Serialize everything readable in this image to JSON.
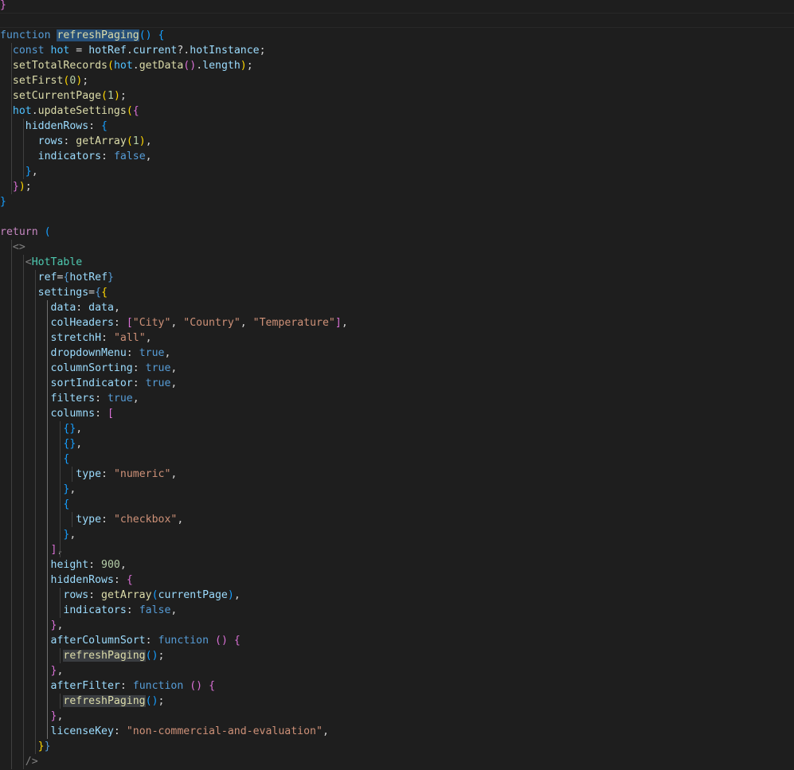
{
  "editor": {
    "background": "#1e1e1e",
    "lines": [
      [
        {
          "t": "}",
          "c": "b2"
        }
      ],
      [],
      [
        {
          "t": "function",
          "c": "kw"
        },
        {
          "t": " ",
          "c": "p"
        },
        {
          "t": "refreshPaging",
          "c": "fn hl"
        },
        {
          "t": "()",
          "c": "b3"
        },
        {
          "t": " ",
          "c": "p"
        },
        {
          "t": "{",
          "c": "b3"
        }
      ],
      [
        {
          "t": "  const",
          "c": "kw"
        },
        {
          "t": " ",
          "c": "p"
        },
        {
          "t": "hot",
          "c": "cst"
        },
        {
          "t": " = ",
          "c": "p"
        },
        {
          "t": "hotRef",
          "c": "var"
        },
        {
          "t": ".",
          "c": "p"
        },
        {
          "t": "current",
          "c": "var"
        },
        {
          "t": "?.",
          "c": "p"
        },
        {
          "t": "hotInstance",
          "c": "var"
        },
        {
          "t": ";",
          "c": "p"
        }
      ],
      [
        {
          "t": "  setTotalRecords",
          "c": "fn"
        },
        {
          "t": "(",
          "c": "b1"
        },
        {
          "t": "hot",
          "c": "cst"
        },
        {
          "t": ".",
          "c": "p"
        },
        {
          "t": "getData",
          "c": "fn"
        },
        {
          "t": "()",
          "c": "b2"
        },
        {
          "t": ".",
          "c": "p"
        },
        {
          "t": "length",
          "c": "var"
        },
        {
          "t": ")",
          "c": "b1"
        },
        {
          "t": ";",
          "c": "p"
        }
      ],
      [
        {
          "t": "  setFirst",
          "c": "fn"
        },
        {
          "t": "(",
          "c": "b1"
        },
        {
          "t": "0",
          "c": "num"
        },
        {
          "t": ")",
          "c": "b1"
        },
        {
          "t": ";",
          "c": "p"
        }
      ],
      [
        {
          "t": "  setCurrentPage",
          "c": "fn"
        },
        {
          "t": "(",
          "c": "b1"
        },
        {
          "t": "1",
          "c": "num"
        },
        {
          "t": ")",
          "c": "b1"
        },
        {
          "t": ";",
          "c": "p"
        }
      ],
      [
        {
          "t": "  hot",
          "c": "cst"
        },
        {
          "t": ".",
          "c": "p"
        },
        {
          "t": "updateSettings",
          "c": "fn"
        },
        {
          "t": "(",
          "c": "b1"
        },
        {
          "t": "{",
          "c": "b2"
        }
      ],
      [
        {
          "t": "    hiddenRows",
          "c": "var"
        },
        {
          "t": ": ",
          "c": "p"
        },
        {
          "t": "{",
          "c": "b3"
        }
      ],
      [
        {
          "t": "      rows",
          "c": "var"
        },
        {
          "t": ": ",
          "c": "p"
        },
        {
          "t": "getArray",
          "c": "fn"
        },
        {
          "t": "(",
          "c": "b1"
        },
        {
          "t": "1",
          "c": "num"
        },
        {
          "t": ")",
          "c": "b1"
        },
        {
          "t": ",",
          "c": "p"
        }
      ],
      [
        {
          "t": "      indicators",
          "c": "var"
        },
        {
          "t": ": ",
          "c": "p"
        },
        {
          "t": "false",
          "c": "kw"
        },
        {
          "t": ",",
          "c": "p"
        }
      ],
      [
        {
          "t": "    ",
          "c": "p"
        },
        {
          "t": "}",
          "c": "b3"
        },
        {
          "t": ",",
          "c": "p"
        }
      ],
      [
        {
          "t": "  ",
          "c": "p"
        },
        {
          "t": "}",
          "c": "b2"
        },
        {
          "t": ")",
          "c": "b1"
        },
        {
          "t": ";",
          "c": "p"
        }
      ],
      [
        {
          "t": "}",
          "c": "b3"
        }
      ],
      [],
      [
        {
          "t": "return",
          "c": "ctl"
        },
        {
          "t": " ",
          "c": "p"
        },
        {
          "t": "(",
          "c": "b3"
        }
      ],
      [
        {
          "t": "  <>",
          "c": "tagp"
        }
      ],
      [
        {
          "t": "    <",
          "c": "tagp"
        },
        {
          "t": "HotTable",
          "c": "tag"
        }
      ],
      [
        {
          "t": "      ref",
          "c": "var"
        },
        {
          "t": "=",
          "c": "p"
        },
        {
          "t": "{",
          "c": "kw"
        },
        {
          "t": "hotRef",
          "c": "var"
        },
        {
          "t": "}",
          "c": "kw"
        }
      ],
      [
        {
          "t": "      settings",
          "c": "var"
        },
        {
          "t": "=",
          "c": "p"
        },
        {
          "t": "{",
          "c": "kw"
        },
        {
          "t": "{",
          "c": "b1"
        }
      ],
      [
        {
          "t": "        data",
          "c": "var"
        },
        {
          "t": ": ",
          "c": "p"
        },
        {
          "t": "data",
          "c": "var"
        },
        {
          "t": ",",
          "c": "p"
        }
      ],
      [
        {
          "t": "        colHeaders",
          "c": "var"
        },
        {
          "t": ": ",
          "c": "p"
        },
        {
          "t": "[",
          "c": "b2"
        },
        {
          "t": "\"City\"",
          "c": "str"
        },
        {
          "t": ", ",
          "c": "p"
        },
        {
          "t": "\"Country\"",
          "c": "str"
        },
        {
          "t": ", ",
          "c": "p"
        },
        {
          "t": "\"Temperature\"",
          "c": "str"
        },
        {
          "t": "]",
          "c": "b2"
        },
        {
          "t": ",",
          "c": "p"
        }
      ],
      [
        {
          "t": "        stretchH",
          "c": "var"
        },
        {
          "t": ": ",
          "c": "p"
        },
        {
          "t": "\"all\"",
          "c": "str"
        },
        {
          "t": ",",
          "c": "p"
        }
      ],
      [
        {
          "t": "        dropdownMenu",
          "c": "var"
        },
        {
          "t": ": ",
          "c": "p"
        },
        {
          "t": "true",
          "c": "kw"
        },
        {
          "t": ",",
          "c": "p"
        }
      ],
      [
        {
          "t": "        columnSorting",
          "c": "var"
        },
        {
          "t": ": ",
          "c": "p"
        },
        {
          "t": "true",
          "c": "kw"
        },
        {
          "t": ",",
          "c": "p"
        }
      ],
      [
        {
          "t": "        sortIndicator",
          "c": "var"
        },
        {
          "t": ": ",
          "c": "p"
        },
        {
          "t": "true",
          "c": "kw"
        },
        {
          "t": ",",
          "c": "p"
        }
      ],
      [
        {
          "t": "        filters",
          "c": "var"
        },
        {
          "t": ": ",
          "c": "p"
        },
        {
          "t": "true",
          "c": "kw"
        },
        {
          "t": ",",
          "c": "p"
        }
      ],
      [
        {
          "t": "        columns",
          "c": "var"
        },
        {
          "t": ": ",
          "c": "p"
        },
        {
          "t": "[",
          "c": "b2"
        }
      ],
      [
        {
          "t": "          ",
          "c": "p"
        },
        {
          "t": "{}",
          "c": "b3"
        },
        {
          "t": ",",
          "c": "p"
        }
      ],
      [
        {
          "t": "          ",
          "c": "p"
        },
        {
          "t": "{}",
          "c": "b3"
        },
        {
          "t": ",",
          "c": "p"
        }
      ],
      [
        {
          "t": "          ",
          "c": "p"
        },
        {
          "t": "{",
          "c": "b3"
        }
      ],
      [
        {
          "t": "            type",
          "c": "var"
        },
        {
          "t": ": ",
          "c": "p"
        },
        {
          "t": "\"numeric\"",
          "c": "str"
        },
        {
          "t": ",",
          "c": "p"
        }
      ],
      [
        {
          "t": "          ",
          "c": "p"
        },
        {
          "t": "}",
          "c": "b3"
        },
        {
          "t": ",",
          "c": "p"
        }
      ],
      [
        {
          "t": "          ",
          "c": "p"
        },
        {
          "t": "{",
          "c": "b3"
        }
      ],
      [
        {
          "t": "            type",
          "c": "var"
        },
        {
          "t": ": ",
          "c": "p"
        },
        {
          "t": "\"checkbox\"",
          "c": "str"
        },
        {
          "t": ",",
          "c": "p"
        }
      ],
      [
        {
          "t": "          ",
          "c": "p"
        },
        {
          "t": "}",
          "c": "b3"
        },
        {
          "t": ",",
          "c": "p"
        }
      ],
      [
        {
          "t": "        ",
          "c": "p"
        },
        {
          "t": "]",
          "c": "b2"
        },
        {
          "t": ",",
          "c": "p"
        }
      ],
      [
        {
          "t": "        height",
          "c": "var"
        },
        {
          "t": ": ",
          "c": "p"
        },
        {
          "t": "900",
          "c": "num"
        },
        {
          "t": ",",
          "c": "p"
        }
      ],
      [
        {
          "t": "        hiddenRows",
          "c": "var"
        },
        {
          "t": ": ",
          "c": "p"
        },
        {
          "t": "{",
          "c": "b2"
        }
      ],
      [
        {
          "t": "          rows",
          "c": "var"
        },
        {
          "t": ": ",
          "c": "p"
        },
        {
          "t": "getArray",
          "c": "fn"
        },
        {
          "t": "(",
          "c": "b3"
        },
        {
          "t": "currentPage",
          "c": "var"
        },
        {
          "t": ")",
          "c": "b3"
        },
        {
          "t": ",",
          "c": "p"
        }
      ],
      [
        {
          "t": "          indicators",
          "c": "var"
        },
        {
          "t": ": ",
          "c": "p"
        },
        {
          "t": "false",
          "c": "kw"
        },
        {
          "t": ",",
          "c": "p"
        }
      ],
      [
        {
          "t": "        ",
          "c": "p"
        },
        {
          "t": "}",
          "c": "b2"
        },
        {
          "t": ",",
          "c": "p"
        }
      ],
      [
        {
          "t": "        afterColumnSort",
          "c": "var"
        },
        {
          "t": ": ",
          "c": "p"
        },
        {
          "t": "function",
          "c": "kw"
        },
        {
          "t": " ",
          "c": "p"
        },
        {
          "t": "()",
          "c": "b2"
        },
        {
          "t": " ",
          "c": "p"
        },
        {
          "t": "{",
          "c": "b2"
        }
      ],
      [
        {
          "t": "          ",
          "c": "p"
        },
        {
          "t": "refreshPaging",
          "c": "fn hl2"
        },
        {
          "t": "()",
          "c": "b3"
        },
        {
          "t": ";",
          "c": "p"
        }
      ],
      [
        {
          "t": "        ",
          "c": "p"
        },
        {
          "t": "}",
          "c": "b2"
        },
        {
          "t": ",",
          "c": "p"
        }
      ],
      [
        {
          "t": "        afterFilter",
          "c": "var"
        },
        {
          "t": ": ",
          "c": "p"
        },
        {
          "t": "function",
          "c": "kw"
        },
        {
          "t": " ",
          "c": "p"
        },
        {
          "t": "()",
          "c": "b2"
        },
        {
          "t": " ",
          "c": "p"
        },
        {
          "t": "{",
          "c": "b2"
        }
      ],
      [
        {
          "t": "          ",
          "c": "p"
        },
        {
          "t": "refreshPaging",
          "c": "fn hl2"
        },
        {
          "t": "()",
          "c": "b3"
        },
        {
          "t": ";",
          "c": "p"
        }
      ],
      [
        {
          "t": "        ",
          "c": "p"
        },
        {
          "t": "}",
          "c": "b2"
        },
        {
          "t": ",",
          "c": "p"
        }
      ],
      [
        {
          "t": "        licenseKey",
          "c": "var"
        },
        {
          "t": ": ",
          "c": "p"
        },
        {
          "t": "\"non-commercial-and-evaluation\"",
          "c": "str"
        },
        {
          "t": ",",
          "c": "p"
        }
      ],
      [
        {
          "t": "      ",
          "c": "p"
        },
        {
          "t": "}",
          "c": "b1"
        },
        {
          "t": "}",
          "c": "kw"
        }
      ],
      [
        {
          "t": "    />",
          "c": "tagp"
        }
      ]
    ]
  }
}
